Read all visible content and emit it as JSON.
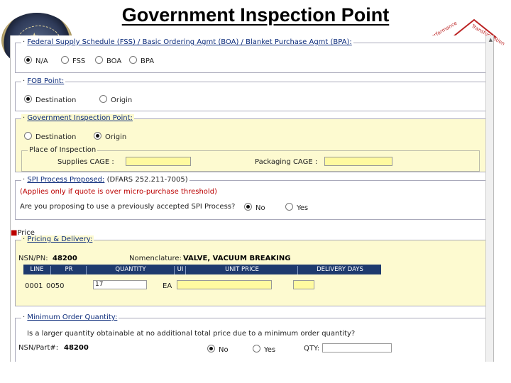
{
  "title": "Government Inspection Point",
  "logo": {
    "word1": "Performance",
    "word2": "Transformation"
  },
  "fss": {
    "legend": "Federal Supply Schedule (FSS) / Basic Ordering Agmt (BOA) / Blanket Purchase Agmt (BPA):",
    "options": [
      {
        "label": "N/A",
        "selected": true
      },
      {
        "label": "FSS",
        "selected": false
      },
      {
        "label": "BOA",
        "selected": false
      },
      {
        "label": "BPA",
        "selected": false
      }
    ]
  },
  "fob": {
    "legend": "FOB Point:",
    "options": [
      {
        "label": "Destination",
        "selected": true
      },
      {
        "label": "Origin",
        "selected": false
      }
    ]
  },
  "gip": {
    "legend": "Government Inspection Point:",
    "options": [
      {
        "label": "Destination",
        "selected": false
      },
      {
        "label": "Origin",
        "selected": true
      }
    ],
    "place_legend": "Place of Inspection",
    "supplies_label": "Supplies CAGE :",
    "packaging_label": "Packaging CAGE :"
  },
  "spi": {
    "legend": "SPI Process Proposed:",
    "ref": "(DFARS 252.211-7005)",
    "note": "(Applies only if quote is over micro-purchase threshold)",
    "question": "Are you proposing to use a previously accepted SPI Process?",
    "options": [
      {
        "label": "No",
        "selected": true
      },
      {
        "label": "Yes",
        "selected": false
      }
    ]
  },
  "price": {
    "section_label": "Price",
    "pricing_legend": "Pricing & Delivery:",
    "nsn_label": "NSN/PN:",
    "nsn_value": "48200",
    "nomen_label": "Nomenclature:",
    "nomen_value": "VALVE, VACUUM BREAKING",
    "columns": [
      "LINE",
      "PR",
      "QUANTITY",
      "UI",
      "UNIT PRICE",
      "DELIVERY DAYS"
    ],
    "row": {
      "line": "0001",
      "pr": "0050",
      "quantity": "17",
      "ui": "EA"
    }
  },
  "moq": {
    "legend": "Minimum Order Quantity:",
    "question": "Is a larger quantity obtainable at no additional total price due to a minimum order quantity?",
    "part_label": "NSN/Part#:",
    "part_value": "48200",
    "options": [
      {
        "label": "No",
        "selected": true
      },
      {
        "label": "Yes",
        "selected": false
      }
    ],
    "qty_label": "QTY:"
  }
}
